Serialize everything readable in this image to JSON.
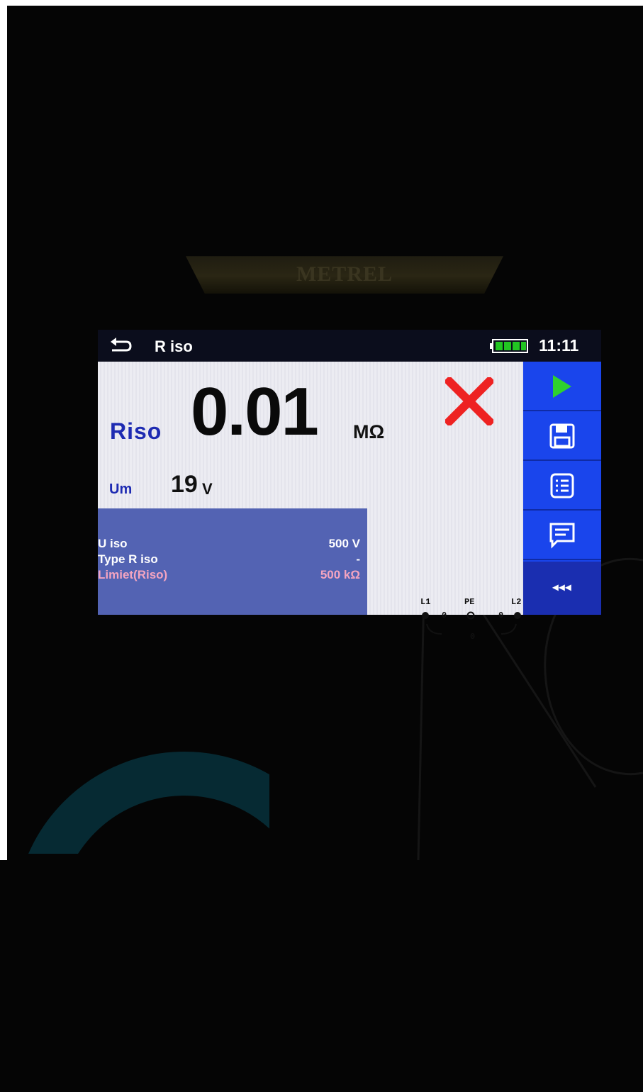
{
  "device": {
    "brand": "METREL"
  },
  "titlebar": {
    "title": "R iso",
    "time": "11:11"
  },
  "measurement": {
    "main_label": "Riso",
    "main_value": "0.01",
    "main_unit": "MΩ",
    "result_status": "fail",
    "sub_label": "Um",
    "sub_value": "19",
    "sub_unit": "V"
  },
  "parameters": [
    {
      "label": "U iso",
      "value": "500 V"
    },
    {
      "label": "Type R iso",
      "value": "-"
    },
    {
      "label": "Limiet(Riso)",
      "value": "500 kΩ"
    }
  ],
  "terminals": {
    "l1_label": "L1",
    "pe_label": "PE",
    "l2_label": "L2",
    "l1_pe_value": "0",
    "pe_l2_value": "0",
    "l1_l2_value": "0"
  },
  "sidebar": {
    "collapse_label": "◂◂◂"
  },
  "colors": {
    "accent_blue": "#1e2bb2",
    "sidebar_blue": "#1a45ec",
    "fail_red": "#ee2222",
    "params_bg": "#5363b3",
    "limit_pink": "#f4a4c0"
  },
  "icons": {
    "back": "back-arrow-icon",
    "battery": "battery-full-icon",
    "fail": "fail-x-icon",
    "start": "play-icon",
    "save": "save-icon",
    "list": "list-icon",
    "comment": "comment-icon"
  }
}
